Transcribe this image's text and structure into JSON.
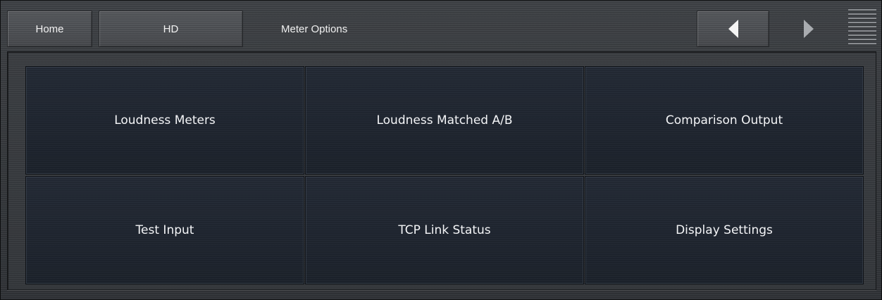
{
  "topbar": {
    "home_label": "Home",
    "hd_label": "HD",
    "title": "Meter Options",
    "back_icon": "triangle-left-icon",
    "forward_icon": "triangle-right-icon",
    "menu_icon": "hamburger-menu-icon"
  },
  "tiles": [
    {
      "label": "Loudness Meters"
    },
    {
      "label": "Loudness Matched A/B"
    },
    {
      "label": "Comparison Output"
    },
    {
      "label": "Test Input"
    },
    {
      "label": "TCP Link Status"
    },
    {
      "label": "Display Settings"
    }
  ],
  "colors": {
    "background": "#3a3d41",
    "tile": "#212833",
    "text": "#f2f2f2",
    "arrow_active": "#f4f4f4",
    "arrow_inactive": "#a9acb0"
  }
}
